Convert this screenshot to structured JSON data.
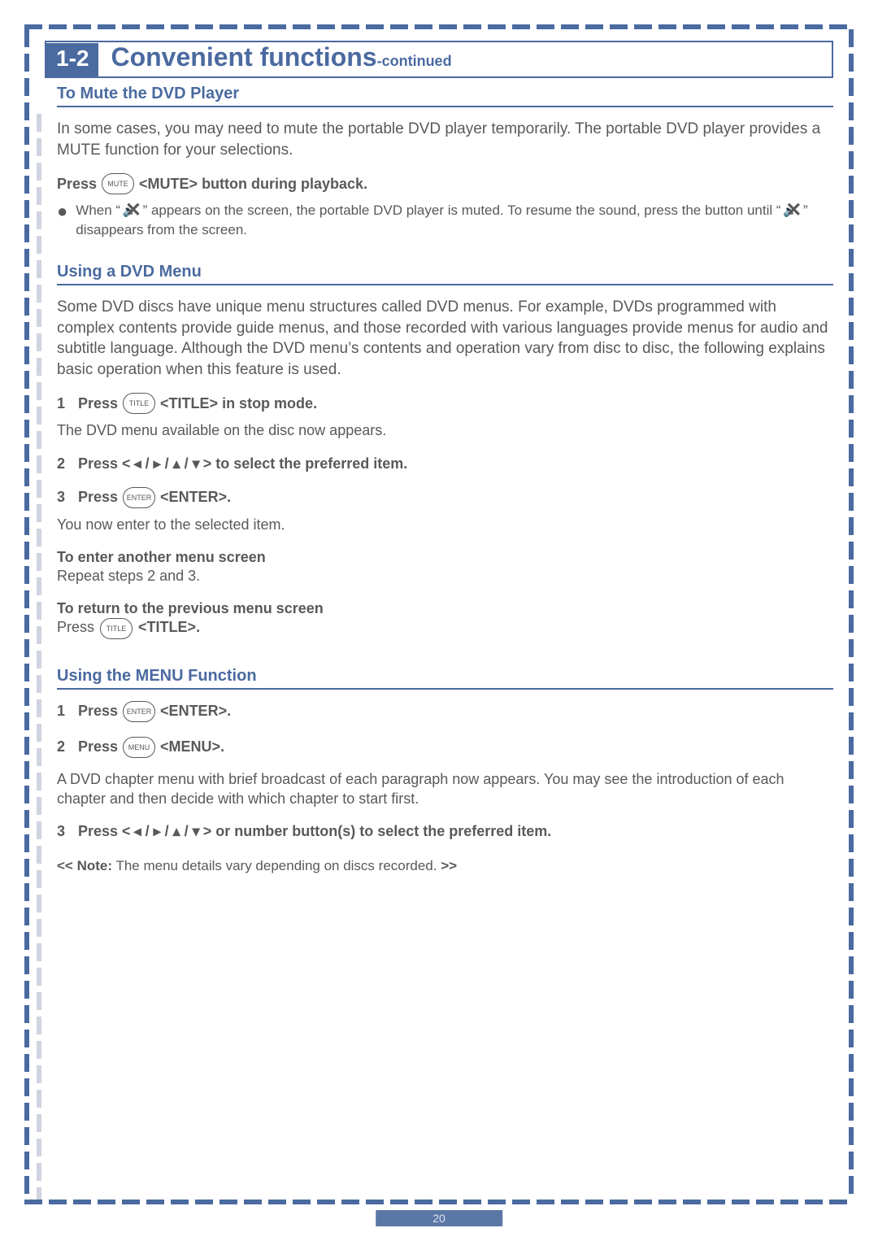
{
  "heading": {
    "num": "1-2",
    "title": "Convenient functions",
    "cont": "-continued"
  },
  "section_mute": {
    "heading": "To Mute the DVD Player",
    "intro": "In some cases, you may need to mute the portable DVD player temporarily. The portable DVD player provides a MUTE function for your selections.",
    "press_prefix": "Press",
    "mute_btn_label": "MUTE",
    "press_suffix": "<MUTE> button during playback.",
    "bullet_a": "When  “ ",
    "bullet_b": " ” appears on the screen, the portable DVD player is muted. To resume the sound, press the button until   “ ",
    "bullet_c": " ” disappears from the screen."
  },
  "section_dvdmenu": {
    "heading": "Using a DVD Menu",
    "intro": "Some DVD discs have unique menu structures called DVD menus. For example, DVDs programmed with complex contents provide guide menus, and those recorded with various languages provide menus for audio and subtitle language. Although the DVD menu’s contents and operation vary from disc to disc, the following explains basic operation when this feature is used.",
    "step1_num": "1",
    "step1_pre": "Press",
    "title_btn": "TITLE",
    "step1_post": "<TITLE> in stop mode.",
    "step1_desc": "The DVD menu available on the disc now appears.",
    "step2_num": "2",
    "step2_text_pre": "Press  < ",
    "step2_arrows": "◂ / ▸ / ▴ / ▾",
    "step2_text_post": " > to select the preferred item.",
    "step3_num": "3",
    "step3_pre": "Press",
    "enter_btn": "ENTER",
    "step3_post": "<ENTER>.",
    "step3_desc": "You now enter to the selected item.",
    "enter_another_h": "To enter another menu screen",
    "enter_another_t": "Repeat steps 2 and 3.",
    "return_prev_h": "To return to the previous menu screen",
    "return_prev_pre": "Press",
    "return_prev_post": "<TITLE>."
  },
  "section_menufn": {
    "heading": "Using the MENU Function",
    "step1_num": "1",
    "step1_pre": "Press",
    "step1_post": "<ENTER>.",
    "step2_num": "2",
    "step2_pre": "Press",
    "menu_btn": "MENU",
    "step2_post": "<MENU>.",
    "desc": "A DVD chapter menu with brief broadcast of each paragraph now appears. You may see the introduction of each chapter and then decide with which chapter to start first.",
    "step3_num": "3",
    "step3_pre": "Press  < ",
    "step3_arrows": "◂ / ▸ / ▴ / ▾",
    "step3_post": "  > or number button(s) to select the preferred item.",
    "note_open": "<<",
    "note_label": "Note:",
    "note_text": "The menu details vary depending on discs recorded.",
    "note_close": ">>"
  },
  "page_number": "20"
}
